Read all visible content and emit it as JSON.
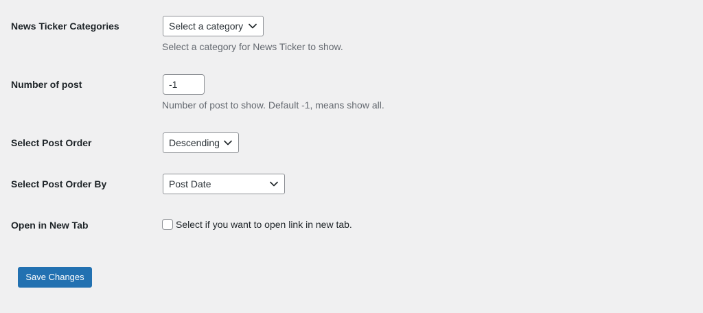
{
  "fields": {
    "categories": {
      "label": "News Ticker Categories",
      "selected": "Select a category",
      "description": "Select a category for News Ticker to show."
    },
    "number_of_post": {
      "label": "Number of post",
      "value": "-1",
      "description": "Number of post to show. Default -1, means show all."
    },
    "post_order": {
      "label": "Select Post Order",
      "selected": "Descending"
    },
    "post_order_by": {
      "label": "Select Post Order By",
      "selected": "Post Date"
    },
    "open_new_tab": {
      "label": "Open in New Tab",
      "checkbox_label": "Select if you want to open link in new tab.",
      "checked": false
    }
  },
  "actions": {
    "save_label": "Save Changes"
  },
  "icons": {
    "dropdown": "chevron-down-icon"
  },
  "colors": {
    "background": "#f0f0f1",
    "primary_button": "#2271b1",
    "field_border": "#8c8f94",
    "description_text": "#646970"
  }
}
